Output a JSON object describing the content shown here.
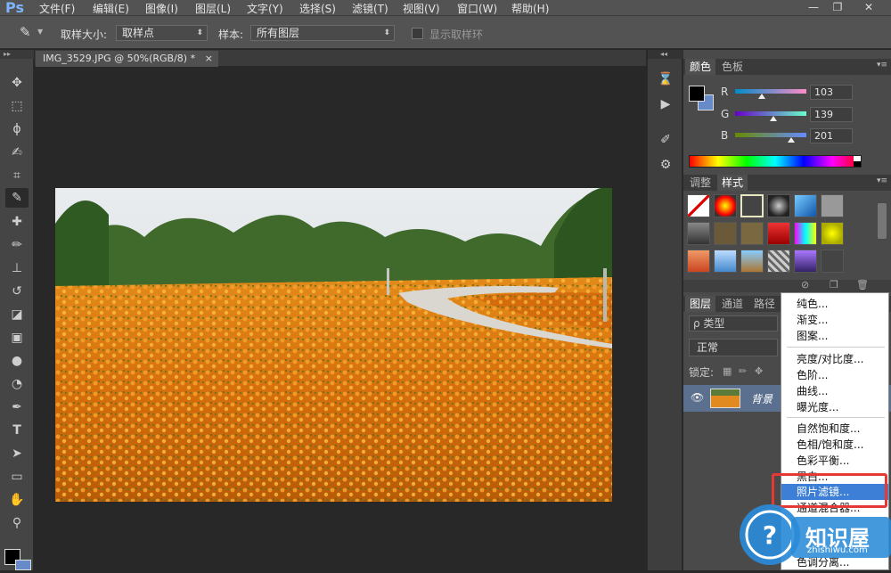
{
  "app": {
    "logo": "Ps"
  },
  "menu": [
    "文件(F)",
    "编辑(E)",
    "图像(I)",
    "图层(L)",
    "文字(Y)",
    "选择(S)",
    "滤镜(T)",
    "视图(V)",
    "窗口(W)",
    "帮助(H)"
  ],
  "window_controls": [
    "—",
    "❐",
    "✕"
  ],
  "options": {
    "sample_size_label": "取样大小:",
    "sample_size_value": "取样点",
    "sample_label": "样本:",
    "sample_value": "所有图层",
    "show_ring_label": "显示取样环"
  },
  "document": {
    "tab_title": "IMG_3529.JPG @ 50%(RGB/8) *",
    "close": "×"
  },
  "color_panel": {
    "tabs": [
      "颜色",
      "色板"
    ],
    "r_label": "R",
    "g_label": "G",
    "b_label": "B",
    "r": "103",
    "g": "139",
    "b": "201",
    "foreground_color": "#000000",
    "background_color": "#678bc9"
  },
  "styles_panel": {
    "tabs": [
      "调整",
      "样式"
    ]
  },
  "layers_panel": {
    "tabs": [
      "图层",
      "通道",
      "路径"
    ],
    "kind_label": "ρ 类型",
    "blend_mode": "正常",
    "lock_label": "锁定:",
    "layer_name": "背景"
  },
  "context_menu": {
    "items": [
      "纯色...",
      "渐变...",
      "图案...",
      "亮度/对比度...",
      "色阶...",
      "曲线...",
      "曝光度...",
      "自然饱和度...",
      "色相/饱和度...",
      "色彩平衡...",
      "黑白...",
      "照片滤镜...",
      "通道混合器...",
      "",
      "",
      "色调分离..."
    ],
    "highlighted": "照片滤镜..."
  },
  "watermark": {
    "text": "知识屋",
    "url": "zhishiwu.com"
  }
}
